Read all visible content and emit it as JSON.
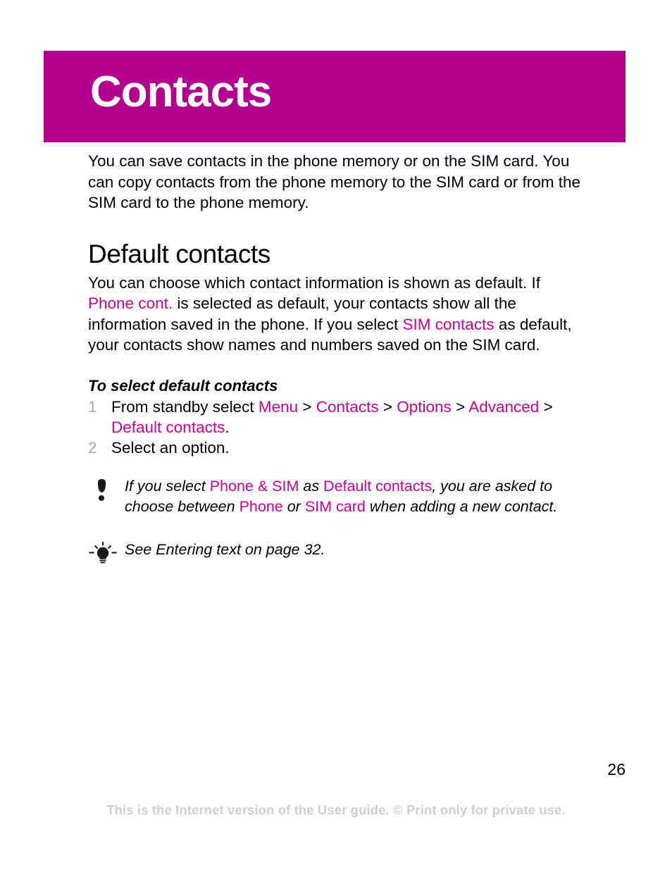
{
  "header": {
    "title": "Contacts",
    "banner_color": "#b4008f",
    "title_color": "#ffffff"
  },
  "accent_color": "#cc0099",
  "intro": {
    "paragraph": "You can save contacts in the phone memory or on the SIM card. You can copy contacts from the phone memory to the SIM card or from the SIM card to the phone memory."
  },
  "section": {
    "heading": "Default contacts",
    "paragraph": {
      "part1": "You can choose which contact information is shown as default. If ",
      "term1": "Phone cont.",
      "part2": " is selected as default, your contacts show all the information saved in the phone. If you select ",
      "term2": "SIM contacts",
      "part3": " as default, your contacts show names and numbers saved on the SIM card."
    }
  },
  "procedure": {
    "title": "To select default contacts",
    "steps": [
      {
        "number": "1",
        "text_before": "From standby select ",
        "path": [
          "Menu",
          "Contacts",
          "Options",
          "Advanced",
          "Default contacts"
        ],
        "separator": ">",
        "text_after": "."
      },
      {
        "number": "2",
        "text": "Select an option."
      }
    ],
    "number_color": "#a9a9a9"
  },
  "note": {
    "icon": "exclamation-icon",
    "part1": "If you select ",
    "term1": "Phone & SIM",
    "part2": " as ",
    "term2": "Default contacts",
    "part3": ", you are asked to choose between ",
    "term3": "Phone",
    "part4": " or ",
    "term4": "SIM card",
    "part5": " when adding a new contact."
  },
  "tip": {
    "icon": "lightbulb-icon",
    "text": "See Entering text on page 32."
  },
  "footer": {
    "page_number": "26",
    "notice": "This is the Internet version of the User guide. © Print only for private use."
  }
}
